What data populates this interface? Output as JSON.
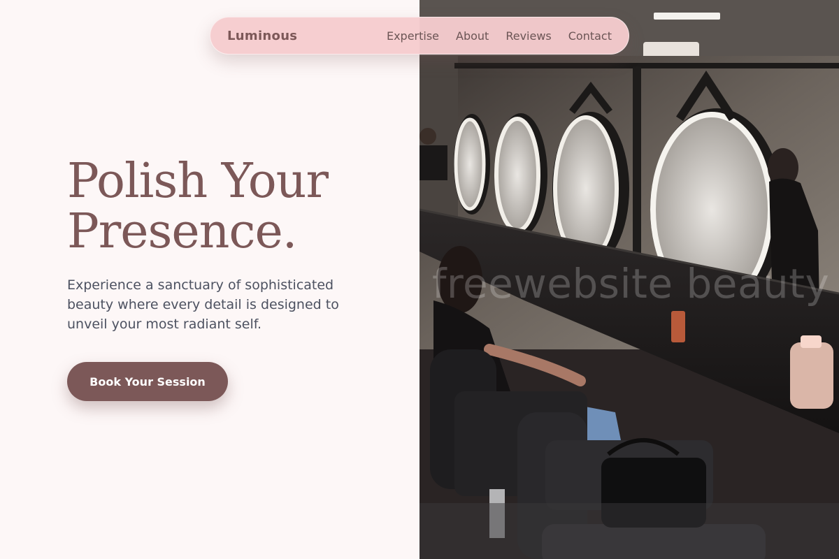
{
  "nav": {
    "brand": "Luminous",
    "links": [
      "Expertise",
      "About",
      "Reviews",
      "Contact"
    ]
  },
  "hero": {
    "title_line1": "Polish Your",
    "title_line2": "Presence.",
    "text": "Experience a sanctuary of sophisticated beauty where every detail is designed to unveil your most radiant self.",
    "cta_label": "Book Your Session"
  },
  "photo": {
    "subject": "salon-interior-image",
    "watermark": "freewebsite beauty"
  },
  "colors": {
    "accent": "#7c5858",
    "nav_bg": "#f6ccce",
    "page_bg": "#fdf7f7",
    "body_text": "#4c5160"
  }
}
